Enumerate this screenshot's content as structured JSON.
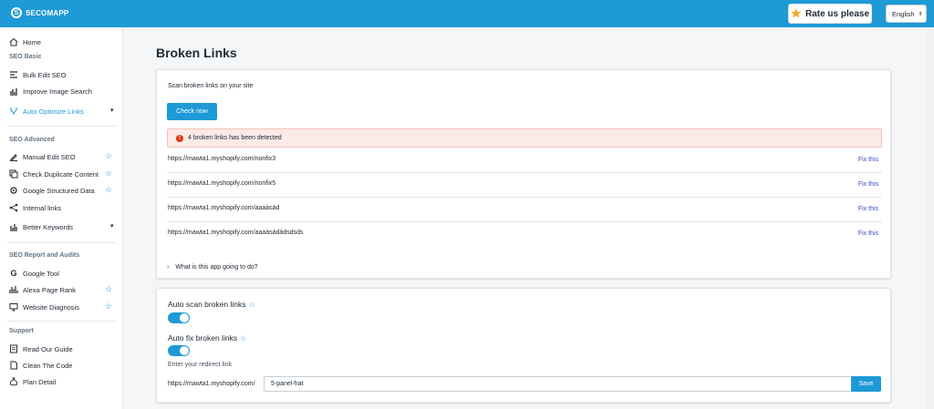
{
  "header": {
    "brand": "SECOMAPP",
    "rate_label": "Rate us please",
    "language": "English",
    "accent_color": "#1e9ad6"
  },
  "sidebar": {
    "home": {
      "label": "Home",
      "icon": "home-icon"
    },
    "sections": [
      {
        "title": "SEO Basic"
      },
      {
        "title": "SEO Advanced"
      },
      {
        "title": "SEO Report and Audits"
      },
      {
        "title": "Support"
      }
    ],
    "items": [
      {
        "label": "Bulk Edit SEO",
        "icon": "pencil-list-icon"
      },
      {
        "label": "Improve Image Search",
        "icon": "image-chart-icon"
      },
      {
        "label": "Auto Optimize Links",
        "icon": "link-fork-icon",
        "active": true
      },
      {
        "label": "Manual Edit SEO",
        "icon": "pencil-icon"
      },
      {
        "label": "Check Duplicate Content",
        "icon": "duplicate-icon"
      },
      {
        "label": "Google Structured Data",
        "icon": "gear-icon"
      },
      {
        "label": "Internal links",
        "icon": "share-icon"
      },
      {
        "label": "Better Keywords",
        "icon": "bar-chart-icon"
      },
      {
        "label": "Google Tool",
        "icon": "google-icon"
      },
      {
        "label": "Alexa Page Rank",
        "icon": "rank-icon"
      },
      {
        "label": "Website Diagnosis",
        "icon": "monitor-icon"
      },
      {
        "label": "Read Our Guide",
        "icon": "guide-icon"
      },
      {
        "label": "Clean The Code",
        "icon": "document-icon"
      },
      {
        "label": "Plan Detail",
        "icon": "money-bag-icon"
      }
    ]
  },
  "main": {
    "title": "Broken Links",
    "scan_card": {
      "description": "Scan broken links on your site",
      "check_label": "Check now",
      "alert_text": "4 broken links has been detected",
      "links": [
        {
          "url": "https://mawta1.myshopify.com/nonfix3",
          "action": "Fix this"
        },
        {
          "url": "https://mawta1.myshopify.com/nonfix5",
          "action": "Fix this"
        },
        {
          "url": "https://mawta1.myshopify.com/aaaàsád",
          "action": "Fix this"
        },
        {
          "url": "https://mawta1.myshopify.com/aaaàsádádsdsds",
          "action": "Fix this"
        }
      ],
      "faq_label": "What is this app going to do?"
    },
    "settings_card": {
      "auto_scan_label": "Auto scan broken links",
      "auto_scan_on": true,
      "auto_fix_label": "Auto fix broken links",
      "auto_fix_on": true,
      "redirect_label": "Enter your redirect link",
      "redirect_prefix": "https://mawta1.myshopify.com/",
      "redirect_value": "5-panel-hat",
      "save_label": "Save"
    }
  }
}
